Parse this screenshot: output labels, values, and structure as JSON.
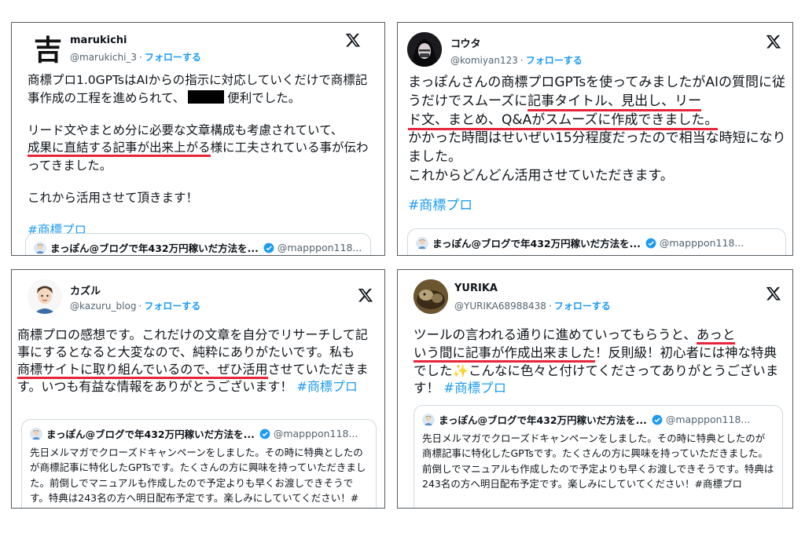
{
  "tweets": [
    {
      "name": "marukichi",
      "handle": "@marukichi_3",
      "follow_label": "フォローする",
      "avatar_glyph": "吉",
      "body": {
        "p1a": "商標プロ1.0GPTsはAIからの指示に対応していくだけで商標記事作成の工程を進められて、",
        "p1b": "便利でした。",
        "p2a": "リード文やまとめ分に必要な文章構成も考慮されていて、",
        "p2_hl": "成果に直結する記事が出来上がる",
        "p2b": "様に工夫されている事が伝わってきました。",
        "p3": "これから活用させて頂きます！",
        "hashtag": "#商標プロ"
      },
      "quote": {
        "name": "まっぽん@ブログで年432万円稼いだ方法を...",
        "handle": "@mapppon118..."
      }
    },
    {
      "name": "コウタ",
      "handle": "@komiyan123",
      "follow_label": "フォローする",
      "body": {
        "p1a": "まっぽんさんの商標プロGPTsを使ってみましたがAIの質問に従うだけでスムーズに",
        "hl1": "記事タイトル、見出し、リー",
        "hl2": "ド文、まとめ、Q&Aがスムーズに作成できました。",
        "p2": "かかった時間はせいぜい15分程度だったので相当な時短になりました。",
        "p3": "これからどんどん活用させていただきます。",
        "hashtag": "#商標プロ"
      },
      "quote": {
        "name": "まっぽん@ブログで年432万円稼いだ方法を...",
        "handle": "@mapppon118..."
      }
    },
    {
      "name": "カズル",
      "handle": "@kazuru_blog",
      "follow_label": "フォローする",
      "body": {
        "p1": "商標プロの感想です。これだけの文章を自分でリサーチして記事にするとなると大変なので、純粋にありがたいです。私も",
        "hl": "商標サイトに取り組んでいるので、ぜひ活用",
        "p2": "させていただきます。いつも有益な情報をありがとうございます！",
        "hashtag": "#商標プロ"
      },
      "quote": {
        "name": "まっぽん@ブログで年432万円稼いだ方法を...",
        "handle": "@mapppon118...",
        "text": "先日メルマガでクローズドキャンペーンをしました。その時に特典としたのが商標記事に特化したGPTsです。たくさんの方に興味を持っていただきました。前倒しでマニュアルも作成したので予定よりも早くお渡しできそうです。特典は243名の方へ明日配布予定です。楽しみにしていてください！#商標プロ"
      }
    },
    {
      "name": "YURIKA",
      "handle": "@YURIKA68988438",
      "follow_label": "フォローする",
      "body": {
        "p1": "ツールの言われる通りに進めていってもらうと、",
        "hl1": "あっと",
        "hl2": "いう間に記事が作成出来ました",
        "p2": "！反則級！初心者には神な特典でした",
        "star": "✨",
        "p3": "こんなに色々と付けてくださってありがとうございます！",
        "hashtag": "#商標プロ"
      },
      "quote": {
        "name": "まっぽん@ブログで年432万円稼いだ方法を...",
        "handle": "@mapppon118...",
        "text": "先日メルマガでクローズドキャンペーンをしました。その時に特典としたのが商標記事に特化したGPTsです。たくさんの方に興味を持っていただきました。前倒しでマニュアルも作成したので予定よりも早くお渡しできそうです。特典は243名の方へ明日配布予定です。楽しみにしていてください！#商標プロ"
      }
    }
  ],
  "colors": {
    "accent": "#1d9bf0",
    "underline": "#e8243a",
    "text": "#0f1419",
    "muted": "#536471"
  }
}
